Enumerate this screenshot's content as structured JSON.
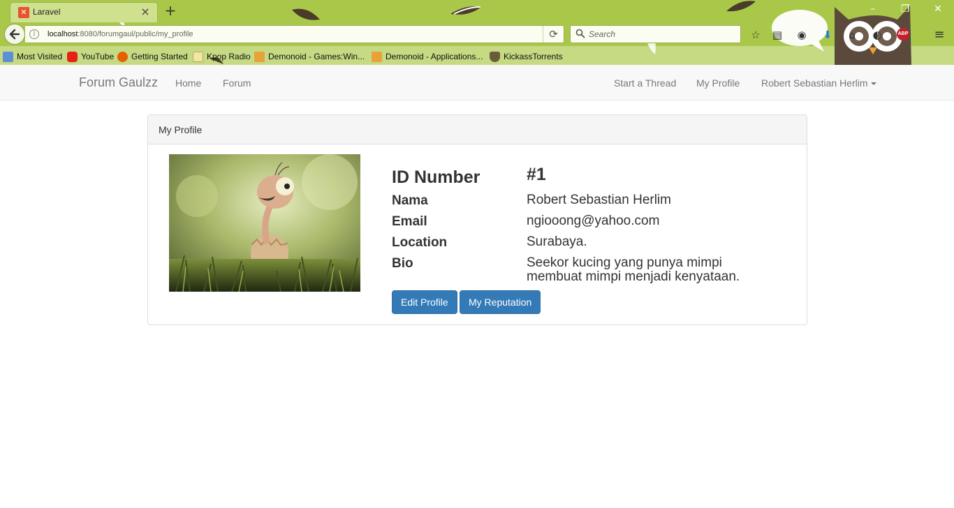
{
  "browser": {
    "tab_title": "Laravel",
    "new_tab_label": "+",
    "url_host": "localhost",
    "url_rest": ":8080/forumgaul/public/my_profile",
    "search_placeholder": "Search",
    "bookmarks": [
      {
        "label": "Most Visited",
        "icon": "bookmark-folder-icon"
      },
      {
        "label": "YouTube",
        "icon": "youtube-icon"
      },
      {
        "label": "Getting Started",
        "icon": "firefox-icon"
      },
      {
        "label": "Kpop Radio",
        "icon": "page-icon"
      },
      {
        "label": "Demonoid - Games:Win...",
        "icon": "rss-icon"
      },
      {
        "label": "Demonoid - Applications...",
        "icon": "rss-icon"
      },
      {
        "label": "KickassTorrents",
        "icon": "shield-icon"
      }
    ],
    "abp_label": "ABP",
    "colors": {
      "theme": "#a9c84a",
      "tab": "#cfe08e"
    }
  },
  "site": {
    "brand": "Forum Gaulzz",
    "nav_left": [
      "Home",
      "Forum"
    ],
    "nav_right": [
      "Start a Thread",
      "My Profile",
      "Robert Sebastian Herlim"
    ]
  },
  "panel": {
    "heading": "My Profile",
    "fields": [
      {
        "label": "ID Number",
        "value": "#1"
      },
      {
        "label": "Nama",
        "value": "Robert Sebastian Herlim"
      },
      {
        "label": "Email",
        "value": "ngiooong@yahoo.com"
      },
      {
        "label": "Location",
        "value": "Surabaya."
      },
      {
        "label": "Bio",
        "value": "Seekor kucing yang punya mimpi membuat mimpi menjadi kenyataan."
      }
    ],
    "buttons": {
      "edit": "Edit Profile",
      "reputation": "My Reputation"
    },
    "accent_color": "#337ab7"
  }
}
